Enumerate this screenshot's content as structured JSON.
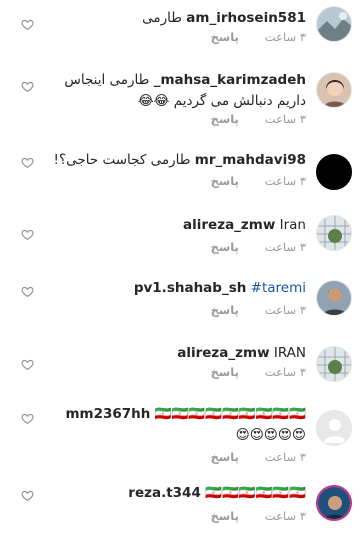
{
  "comments": [
    {
      "username": "am_irhosein581",
      "text": "طارمی",
      "time": "۳ ساعت",
      "reply": "پاسخ",
      "avatar": "landscape"
    },
    {
      "username": "mahsa_karimzadeh_",
      "text": "طارمی اینجاس داریم دنبالش می گردیم",
      "emoji": "😂😂",
      "time": "۳ ساعت",
      "reply": "پاسخ",
      "avatar": "portrait-woman"
    },
    {
      "username": "mr_mahdavi98",
      "text": "طارمی کجاست حاجی؟!",
      "time": "۳ ساعت",
      "reply": "پاسخ",
      "avatar": "black"
    },
    {
      "username": "alireza_zmw",
      "text": "Iran",
      "time": "۳ ساعت",
      "reply": "پاسخ",
      "avatar": "football"
    },
    {
      "username": "pv1.shahab_sh",
      "text": "#taremi",
      "time": "۳ ساعت",
      "reply": "پاسخ",
      "avatar": "portrait-man"
    },
    {
      "username": "alireza_zmw",
      "text": "IRAN",
      "time": "۳ ساعت",
      "reply": "پاسخ",
      "avatar": "football"
    },
    {
      "username": "mm2367hh",
      "text": "🇮🇷🇮🇷🇮🇷🇮🇷🇮🇷🇮🇷🇮🇷🇮🇷🇮🇷",
      "emoji": "😍😍😍😍😍",
      "time": "۳ ساعت",
      "reply": "پاسخ",
      "avatar": "default"
    },
    {
      "username": "reza.t344",
      "text": "🇮🇷🇮🇷🇮🇷🇮🇷🇮🇷🇮🇷",
      "time": "۳ ساعت",
      "reply": "پاسخ",
      "avatar": "story-ring"
    }
  ],
  "colors": {
    "username": "#262626",
    "meta": "#9a9a9a",
    "hashtag": "#1a56a8",
    "heart_outline": "#8e8e8e"
  },
  "icons": {
    "like": "heart-outline-icon"
  }
}
